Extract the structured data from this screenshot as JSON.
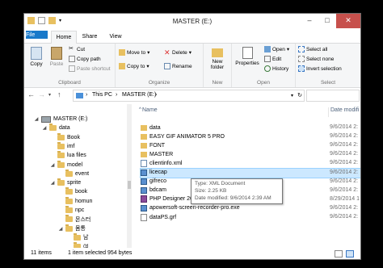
{
  "window": {
    "title": "MASTER (E:)"
  },
  "ribbon_tabs": [
    "File",
    "Home",
    "Share",
    "View"
  ],
  "ribbon": {
    "clipboard": {
      "copy": "Copy",
      "paste": "Paste",
      "cut": "Cut",
      "copy_path": "Copy path",
      "paste_shortcut": "Paste shortcut",
      "label": "Clipboard"
    },
    "organize": {
      "move_to": "Move to",
      "copy_to": "Copy to",
      "delete": "Delete",
      "rename": "Rename",
      "label": "Organize"
    },
    "new": {
      "new_folder_line1": "New",
      "new_folder_line2": "folder",
      "label": "New"
    },
    "open": {
      "properties": "Properties",
      "open": "Open",
      "edit": "Edit",
      "history": "History",
      "label": "Open"
    },
    "select": {
      "select_all": "Select all",
      "select_none": "Select none",
      "invert": "Invert selection",
      "label": "Select"
    }
  },
  "address": {
    "this_pc": "This PC",
    "drive": "MASTER (E:)",
    "sep": "›"
  },
  "nav_tree": [
    {
      "label": "MASTER (E:)",
      "type": "drive",
      "indent": 0,
      "arrow": "◢"
    },
    {
      "label": "data",
      "type": "folder",
      "indent": 1,
      "arrow": "◢"
    },
    {
      "label": "Book",
      "type": "folder",
      "indent": 2,
      "arrow": ""
    },
    {
      "label": "imf",
      "type": "folder",
      "indent": 2,
      "arrow": ""
    },
    {
      "label": "lua files",
      "type": "folder",
      "indent": 2,
      "arrow": ""
    },
    {
      "label": "model",
      "type": "folder",
      "indent": 2,
      "arrow": "◢"
    },
    {
      "label": "event",
      "type": "folder",
      "indent": 3,
      "arrow": ""
    },
    {
      "label": "sprite",
      "type": "folder",
      "indent": 2,
      "arrow": "◢"
    },
    {
      "label": "book",
      "type": "folder",
      "indent": 3,
      "arrow": ""
    },
    {
      "label": "homun",
      "type": "folder",
      "indent": 3,
      "arrow": ""
    },
    {
      "label": "npc",
      "type": "folder",
      "indent": 3,
      "arrow": ""
    },
    {
      "label": "몬스터",
      "type": "folder",
      "indent": 3,
      "arrow": ""
    },
    {
      "label": "몸통",
      "type": "folder",
      "indent": 3,
      "arrow": "◢"
    },
    {
      "label": "남",
      "type": "folder",
      "indent": 4,
      "arrow": ""
    },
    {
      "label": "여",
      "type": "folder",
      "indent": 4,
      "arrow": ""
    }
  ],
  "columns": {
    "name": "Name",
    "date": "Date modifi"
  },
  "files": [
    {
      "name": "data",
      "date": "9/6/2014 2:",
      "icon": "folder"
    },
    {
      "name": "EASY GIF ANIMATOR 5 PRO",
      "date": "9/6/2014 2:",
      "icon": "folder"
    },
    {
      "name": "FONT",
      "date": "9/6/2014 2:",
      "icon": "folder"
    },
    {
      "name": "MASTER",
      "date": "9/6/2014 2:",
      "icon": "folder"
    },
    {
      "name": "clientinfo.xml",
      "date": "9/6/2014 2:",
      "icon": "xml"
    },
    {
      "name": "licecap",
      "date": "9/6/2014 2:",
      "icon": "exe"
    },
    {
      "name": "gifreco",
      "date": "9/6/2014 2:",
      "icon": "exe"
    },
    {
      "name": "bdcam",
      "date": "9/6/2014 2:",
      "icon": "exe"
    },
    {
      "name": "PHP Designer 2012 Versi 8 full.rar",
      "date": "8/29/2014 1",
      "icon": "rar"
    },
    {
      "name": "apowersoft-screen-recorder-pro.exe",
      "date": "9/6/2014 2:",
      "icon": "exe"
    },
    {
      "name": "dataPS.grf",
      "date": "9/6/2014 2:",
      "icon": "file"
    }
  ],
  "tooltip": {
    "type": "Type: XML Document",
    "size": "Size: 2.25 KB",
    "date": "Date modified: 9/6/2014 2:39 AM"
  },
  "status": {
    "items": "11 items",
    "selected": "1 item selected  954 bytes"
  }
}
